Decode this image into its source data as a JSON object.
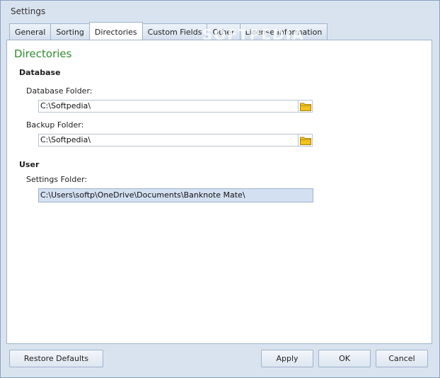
{
  "window": {
    "title": "Settings"
  },
  "tabs": [
    {
      "label": "General"
    },
    {
      "label": "Sorting"
    },
    {
      "label": "Directories"
    },
    {
      "label": "Custom Fields"
    },
    {
      "label": "Other"
    },
    {
      "label": "License Information"
    }
  ],
  "active_tab": "Directories",
  "panel": {
    "title": "Directories",
    "database": {
      "group_label": "Database",
      "db_folder_label": "Database Folder:",
      "db_folder_value": "C:\\Softpedia\\",
      "backup_folder_label": "Backup Folder:",
      "backup_folder_value": "C:\\Softpedia\\"
    },
    "user": {
      "group_label": "User",
      "settings_folder_label": "Settings Folder:",
      "settings_folder_value": "C:\\Users\\softp\\OneDrive\\Documents\\Banknote Mate\\"
    }
  },
  "buttons": {
    "restore_defaults": "Restore Defaults",
    "apply": "Apply",
    "ok": "OK",
    "cancel": "Cancel"
  },
  "watermark": "SOFTPEDIA",
  "icons": {
    "folder": "folder-icon"
  },
  "colors": {
    "section_title": "#2e8b2e",
    "folder_icon": "#f2c21b",
    "window_bg": "#d9e3f0"
  }
}
